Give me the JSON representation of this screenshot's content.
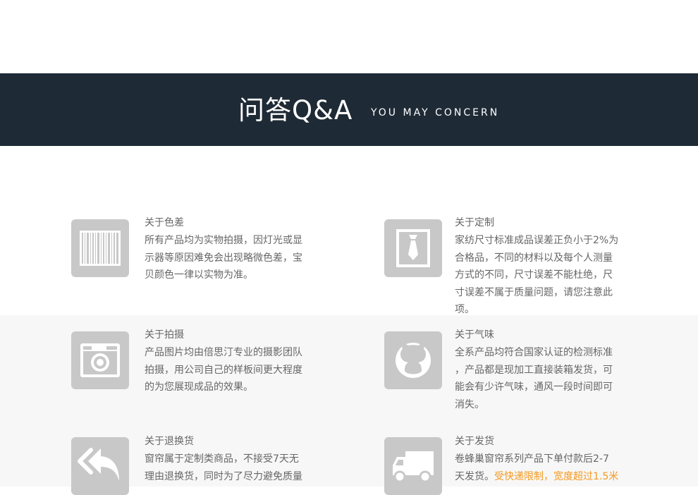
{
  "header": {
    "title": "问答Q&A",
    "subtitle": "YOU MAY CONCERN"
  },
  "items": [
    {
      "title": "关于色差",
      "icon": "barcode-icon",
      "lines": [
        "所有产品均为实物拍摄，因灯光或显",
        "示器等原因难免会出现略微色差，宝",
        "贝颜色一律以实物为准。"
      ]
    },
    {
      "title": "关于定制",
      "icon": "tie-icon",
      "lines": [
        "家纺尺寸标准成品误差正负小于2%为",
        "合格品，不同的材料以及每个人测量",
        "方式的不同，尺寸误差不能杜绝，尺",
        "寸误差不属于质量问题，请您注意此",
        "项。"
      ]
    },
    {
      "title": "关于拍摄",
      "icon": "camera-icon",
      "lines": [
        "产品图片均由倍思汀专业的摄影团队",
        "拍摄，用公司自己的样板间更大程度",
        "的为您展现成品的效果。"
      ]
    },
    {
      "title": "关于气味",
      "icon": "github-cat-icon",
      "lines": [
        "全系产品均符合国家认证的检测标准",
        "，产品都是现加工直接装箱发货，可",
        "能会有少许气味，通风一段时间即可",
        "消失。"
      ]
    },
    {
      "title": "关于退换货",
      "icon": "reply-all-icon",
      "lines": [
        "窗帘属于定制类商品，不接受7天无",
        "理由退换货，同时为了尽力避免质量"
      ]
    },
    {
      "title": "关于发货",
      "icon": "truck-icon",
      "lines": [
        "卷蜂巢窗帘系列产品下单付款后2-7"
      ],
      "line2_plain": "天发货。",
      "line2_highlight": "受快递限制，宽度超过1.5米"
    }
  ],
  "colors": {
    "banner_bg": "#1e2a35",
    "icon_bg": "#c8c8c8",
    "highlight": "#f39a21",
    "gray_band": "#f7f7f7"
  }
}
